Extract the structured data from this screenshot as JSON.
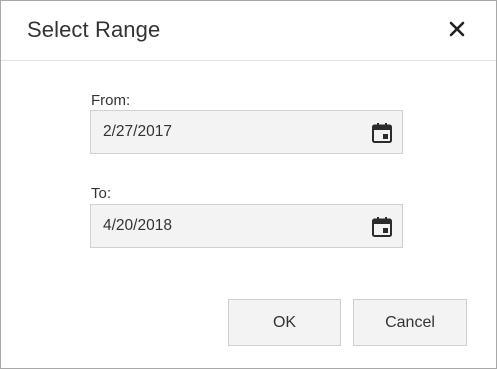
{
  "dialog": {
    "title": "Select Range",
    "close_icon": "close-icon"
  },
  "from": {
    "label": "From:",
    "value": "2/27/2017",
    "icon": "calendar-icon"
  },
  "to": {
    "label": "To:",
    "value": "4/20/2018",
    "icon": "calendar-icon"
  },
  "buttons": {
    "ok_label": "OK",
    "cancel_label": "Cancel"
  },
  "colors": {
    "field_background": "#f3f3f3",
    "border": "#d0d0d0",
    "text": "#333333"
  }
}
